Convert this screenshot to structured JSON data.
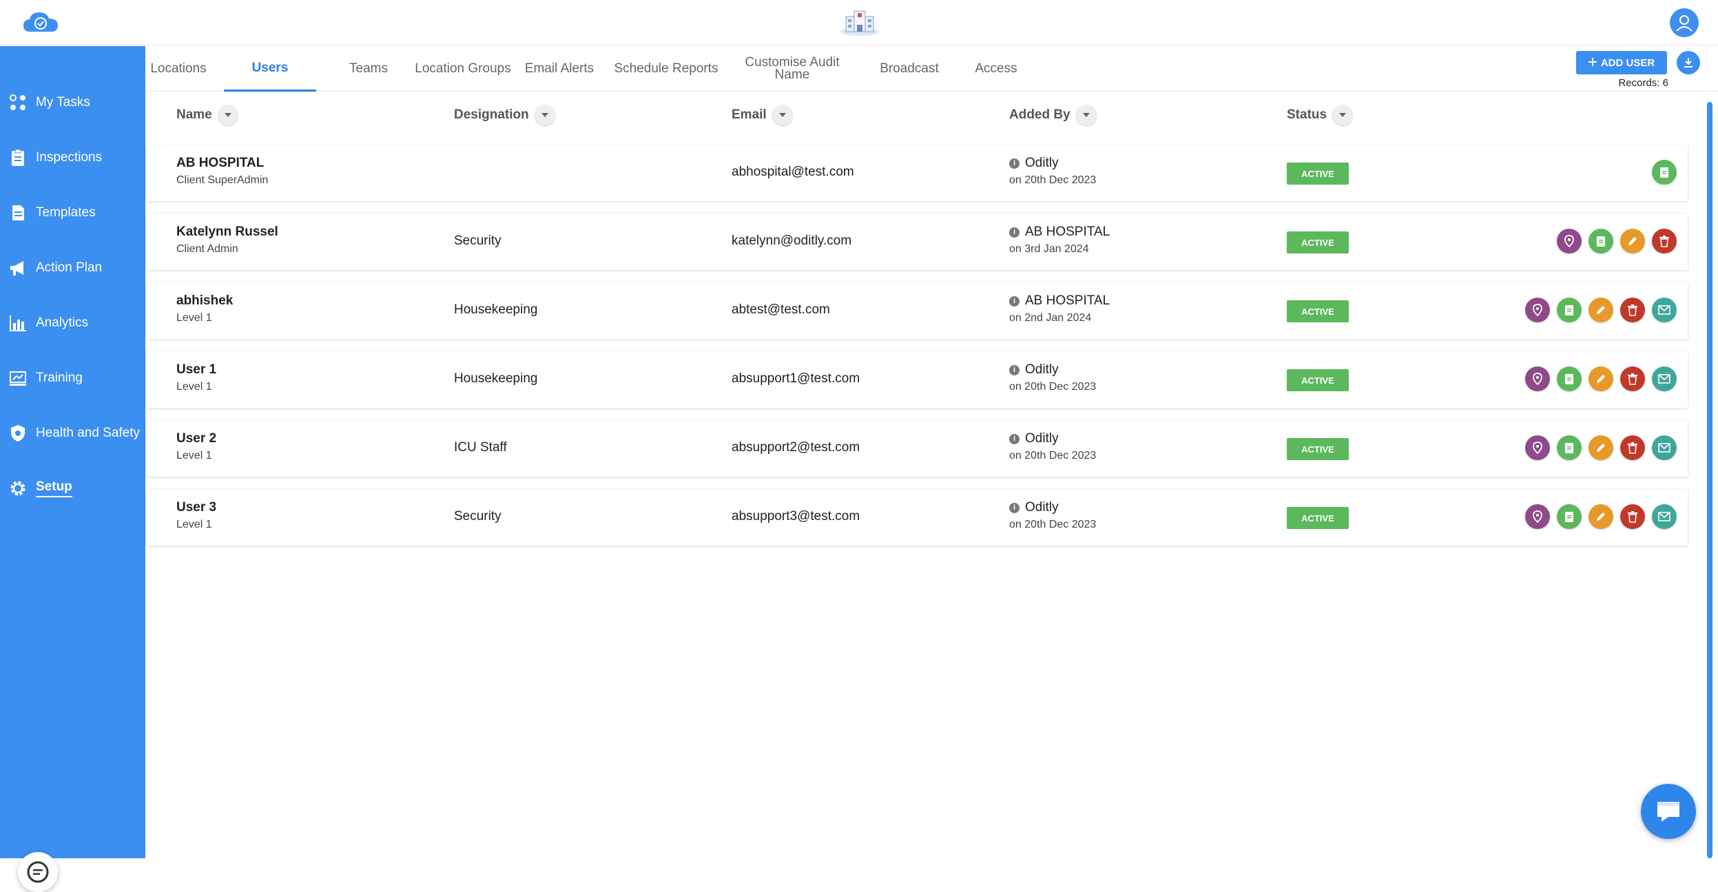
{
  "colors": {
    "primary": "#3b8ff0",
    "active_badge": "#5cb85c",
    "tab_active": "#2f7fe4"
  },
  "sidebar": {
    "items": [
      {
        "label": "My Tasks",
        "icon": "tasks-icon"
      },
      {
        "label": "Inspections",
        "icon": "clipboard-icon"
      },
      {
        "label": "Templates",
        "icon": "document-icon"
      },
      {
        "label": "Action Plan",
        "icon": "megaphone-icon"
      },
      {
        "label": "Analytics",
        "icon": "chart-icon"
      },
      {
        "label": "Training",
        "icon": "training-icon"
      },
      {
        "label": "Health and Safety",
        "icon": "shield-icon"
      },
      {
        "label": "Setup",
        "icon": "gear-icon"
      }
    ],
    "active": "Setup"
  },
  "tabs": [
    {
      "label": "Locations"
    },
    {
      "label": "Users"
    },
    {
      "label": "Teams"
    },
    {
      "label": "Location Groups"
    },
    {
      "label": "Email Alerts"
    },
    {
      "label": "Schedule Reports"
    },
    {
      "label": "Customise Audit Name"
    },
    {
      "label": "Broadcast"
    },
    {
      "label": "Access"
    }
  ],
  "active_tab": "Users",
  "toolbar": {
    "add_user_label": "ADD USER",
    "records": "Records: 6"
  },
  "columns": [
    "Name",
    "Designation",
    "Email",
    "Added By",
    "Status"
  ],
  "users": [
    {
      "name": "AB HOSPITAL",
      "role": "Client SuperAdmin",
      "designation": "",
      "email": "abhospital@test.com",
      "added_by": "Oditly",
      "added_on": "on 20th Dec 2023",
      "status": "ACTIVE",
      "actions": [
        "doc"
      ]
    },
    {
      "name": "Katelynn Russel",
      "role": "Client Admin",
      "designation": "Security",
      "email": "katelynn@oditly.com",
      "added_by": "AB HOSPITAL",
      "added_on": "on 3rd Jan 2024",
      "status": "ACTIVE",
      "actions": [
        "loc",
        "doc",
        "edit",
        "del"
      ]
    },
    {
      "name": "abhishek",
      "role": "Level 1",
      "designation": "Housekeeping",
      "email": "abtest@test.com",
      "added_by": "AB HOSPITAL",
      "added_on": "on 2nd Jan 2024",
      "status": "ACTIVE",
      "actions": [
        "loc",
        "doc",
        "edit",
        "del",
        "mail"
      ]
    },
    {
      "name": "User 1",
      "role": "Level 1",
      "designation": "Housekeeping",
      "email": "absupport1@test.com",
      "added_by": "Oditly",
      "added_on": "on 20th Dec 2023",
      "status": "ACTIVE",
      "actions": [
        "loc",
        "doc",
        "edit",
        "del",
        "mail"
      ]
    },
    {
      "name": "User 2",
      "role": "Level 1",
      "designation": "ICU Staff",
      "email": "absupport2@test.com",
      "added_by": "Oditly",
      "added_on": "on 20th Dec 2023",
      "status": "ACTIVE",
      "actions": [
        "loc",
        "doc",
        "edit",
        "del",
        "mail"
      ]
    },
    {
      "name": "User 3",
      "role": "Level 1",
      "designation": "Security",
      "email": "absupport3@test.com",
      "added_by": "Oditly",
      "added_on": "on 20th Dec 2023",
      "status": "ACTIVE",
      "actions": [
        "loc",
        "doc",
        "edit",
        "del",
        "mail"
      ]
    }
  ]
}
